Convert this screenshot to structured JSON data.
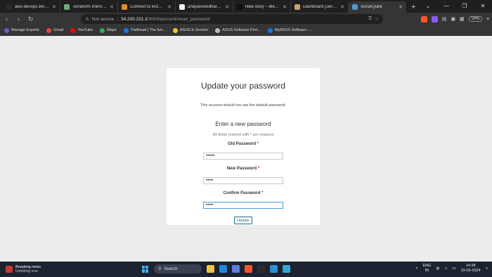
{
  "browser": {
    "tabs": [
      {
        "title": "aws-devops-zero-to-hero",
        "color": "#2b2b2b"
      },
      {
        "title": "Terraform Interview Q&A",
        "color": "#6fa97a"
      },
      {
        "title": "Connect to instance | EC",
        "color": "#e4892d"
      },
      {
        "title": "uniquesreedhar/Chatbot",
        "color": "#f0f0f0"
      },
      {
        "title": "New story – Medium",
        "color": "#111111"
      },
      {
        "title": "Dashboard [Jenkins]",
        "color": "#c9a36a"
      },
      {
        "title": "SonarQube",
        "color": "#4e9bcd",
        "active": true
      }
    ],
    "newtab": "+",
    "window_controls": [
      "⌄",
      "—",
      "❐",
      "✕"
    ],
    "address": {
      "security": "Not secure",
      "host": "34.200.221.3",
      "path": ":9000/account/reset_password"
    },
    "vpn": "VPN",
    "bookmarks": [
      {
        "label": "Manage Exports",
        "color": "#6a5acd"
      },
      {
        "label": "Gmail",
        "color": "#ea4335"
      },
      {
        "label": "YouTube",
        "color": "#ff0000"
      },
      {
        "label": "Maps",
        "color": "#34a853"
      },
      {
        "label": "Trailhead | The fun...",
        "color": "#1a73e8"
      },
      {
        "label": "ASUS E-Service",
        "color": "#f2c230"
      },
      {
        "label": "ASUS Software Port...",
        "color": "#bbbbbb"
      },
      {
        "label": "MyASUS Software -...",
        "color": "#1a73e8"
      }
    ]
  },
  "form": {
    "title": "Update your password",
    "note": "This account should not use the default password.",
    "subtitle": "Enter a new password",
    "required_pre": "All fields marked with ",
    "required_star": "*",
    "required_post": " are required",
    "old_label": "Old Password",
    "old_value": "••••••",
    "new_label": "New Password",
    "new_value": "•••••",
    "confirm_label": "Confirm Password",
    "confirm_value": "•••••",
    "star": "*",
    "button": "Update"
  },
  "taskbar": {
    "news_title": "Breaking news",
    "news_sub": "Unfolding now",
    "search": "Search",
    "lang1": "ENG",
    "lang2": "IN",
    "time": "14:28",
    "date": "10-03-2024",
    "apps": [
      {
        "name": "explorer",
        "color": "#f4c542"
      },
      {
        "name": "edge",
        "color": "#1f8ad7"
      },
      {
        "name": "store",
        "color": "#5d7de0"
      },
      {
        "name": "brave",
        "color": "#fb542b"
      },
      {
        "name": "terminal",
        "color": "#2d2d2d"
      },
      {
        "name": "vscode",
        "color": "#2a8fd7"
      },
      {
        "name": "notepad",
        "color": "#31a8d8"
      }
    ]
  }
}
